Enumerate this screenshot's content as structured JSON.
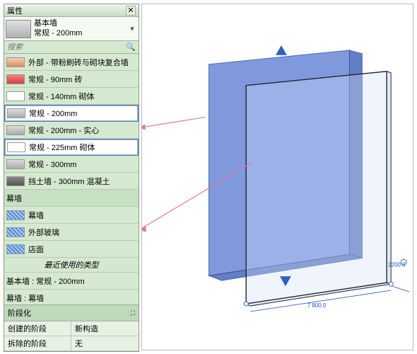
{
  "panel": {
    "title": "属性"
  },
  "selectedType": {
    "name": "基本墙",
    "subtype": "常规 - 200mm"
  },
  "search": {
    "placeholder": "搜索"
  },
  "walls": [
    {
      "label": "外部 - 带粉刷砖与砌块复合墙",
      "sw": "sw-brick"
    },
    {
      "label": "常规 - 90mm 砖",
      "sw": "sw-red"
    },
    {
      "label": "常规 - 140mm 砌体",
      "sw": "sw-white"
    },
    {
      "label": "常规 - 200mm",
      "sw": "sw-solid",
      "selected": true
    },
    {
      "label": "常规 - 200mm - 实心",
      "sw": "sw-solid"
    },
    {
      "label": "常规 - 225mm 砌体",
      "sw": "sw-white",
      "selected": true
    },
    {
      "label": "常规 - 300mm",
      "sw": "sw-solid"
    },
    {
      "label": "挡土墙 - 300mm 混凝土",
      "sw": "sw-dark"
    }
  ],
  "curtainHead": "幕墙",
  "curtain": [
    {
      "label": "幕墙",
      "sw": "sw-curt"
    },
    {
      "label": "外部玻璃",
      "sw": "sw-curt"
    },
    {
      "label": "店面",
      "sw": "sw-curt"
    }
  ],
  "recentLabel": "最近使用的类型",
  "recent": [
    "基本墙 : 常规 - 200mm",
    "幕墙 : 幕墙"
  ],
  "phase": {
    "header": "阶段化",
    "rows": [
      {
        "label": "创建的阶段",
        "value": "新构造"
      },
      {
        "label": "拆除的阶段",
        "value": "无"
      }
    ]
  },
  "dims": {
    "width": "7 800.0",
    "depth": "2200.0"
  }
}
